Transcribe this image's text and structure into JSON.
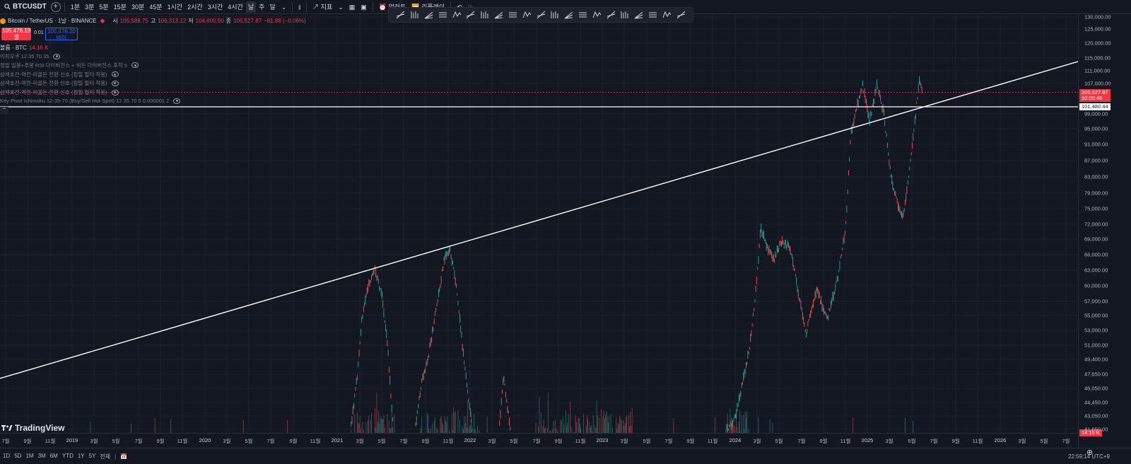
{
  "topbar": {
    "symbol": "BTCUSDT",
    "intervals": [
      "1분",
      "3분",
      "5분",
      "15분",
      "30분",
      "45분",
      "1시간",
      "2시간",
      "3시간",
      "4시간",
      "날",
      "주",
      "달"
    ],
    "active_interval": "날",
    "indicators_label": "지표",
    "alert_label": "얼러트",
    "replay_label": "리플레이"
  },
  "legend": {
    "title": "Bitcoin / TetherUS · 1날 · BINANCE",
    "open_key": "시",
    "open": "105,589.75",
    "high_key": "고",
    "high": "106,313.12",
    "low_key": "저",
    "low": "104,600.50",
    "close_key": "종",
    "close": "105,527.87",
    "change": "−61.88 (−0.06%)",
    "sell_price": "105,476.19",
    "sell_label": "셀",
    "spread": "0.01",
    "buy_price": "105,476.20",
    "buy_label": "바이",
    "volume_label": "볼륨 · BTC",
    "volume_value": "14.16 K",
    "indicators": [
      "이치모쿠 12 35 70 35",
      "정밀 일봉+주봉 RSI 다이버전스 + 히든 다이버전스 포착 5",
      "삼색호전-역전-리골든 전환 신호 (정밀 필터 적용)",
      "삼색호전-역전-리골든 전환 신호 (정밀 필터 적용)",
      "삼색호전-역전-리골든 전환 신호 (정밀 필터 적용)",
      "Key Pivot Ichimoku 12-35-70 (Buy/Sell Hot-Spot) 12 35 70 5 0.000001 2"
    ]
  },
  "price_axis": {
    "labels": [
      "130,000.00",
      "125,000.00",
      "120,000.00",
      "115,000.00",
      "111,000.00",
      "107,000.00",
      "99,000.00",
      "95,000.00",
      "91,000.00",
      "87,000.00",
      "83,000.00",
      "79,000.00",
      "75,000.00",
      "72,000.00",
      "69,000.00",
      "66,000.00",
      "63,000.00",
      "60,000.00",
      "57,000.00",
      "55,000.00",
      "53,000.00",
      "51,000.00",
      "49,400.00",
      "47,650.00",
      "46,050.00",
      "44,450.00",
      "43,050.00",
      "41,650.00"
    ],
    "last_price": "105,527.87",
    "countdown": "10:00:46",
    "line_price": "101,480.44",
    "volume_tag": "14.16 K",
    "colors": {
      "last_price_bg": "#f23645",
      "line_price_bg": "#ffffff",
      "volume_bg": "#f23645"
    }
  },
  "time_axis": {
    "labels": [
      "7월",
      "9월",
      "11월",
      "2019",
      "3월",
      "5월",
      "7월",
      "9월",
      "11월",
      "2020",
      "3월",
      "5월",
      "7월",
      "9월",
      "11월",
      "2021",
      "3월",
      "5월",
      "7월",
      "9월",
      "11월",
      "2022",
      "3월",
      "5월",
      "7월",
      "9월",
      "11월",
      "2023",
      "3월",
      "5월",
      "7월",
      "9월",
      "11월",
      "2024",
      "3월",
      "5월",
      "7월",
      "9월",
      "11월",
      "2025",
      "3월",
      "5월",
      "7월",
      "9월",
      "11월",
      "2026",
      "3월",
      "5월",
      "7월"
    ]
  },
  "bottombar": {
    "ranges": [
      "1D",
      "5D",
      "1M",
      "3M",
      "6M",
      "YTD",
      "1Y",
      "5Y",
      "전체"
    ],
    "time": "22:59:14 UTC+9"
  },
  "branding": {
    "logo_text": "TradingView"
  },
  "colors": {
    "bg": "#131722",
    "up": "#26a69a",
    "down": "#ef5350",
    "trendline": "#ffffff"
  }
}
